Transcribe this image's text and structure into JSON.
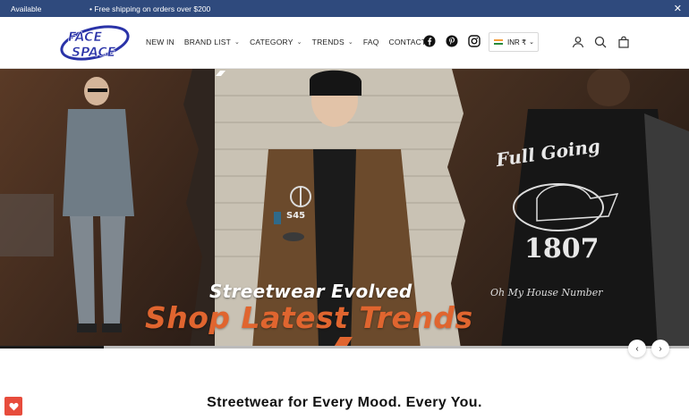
{
  "announcement": {
    "left_text": "Available",
    "shipping_text": "• Free shipping on orders over $200",
    "close_icon": "close-icon"
  },
  "header": {
    "logo_text_top": "FACE",
    "logo_text_bottom": "SPACE",
    "brand_color": "#2a33a8",
    "nav": [
      {
        "label": "NEW IN",
        "has_dropdown": false
      },
      {
        "label": "BRAND LIST",
        "has_dropdown": true
      },
      {
        "label": "CATEGORY",
        "has_dropdown": true
      },
      {
        "label": "TRENDS",
        "has_dropdown": true
      },
      {
        "label": "FAQ",
        "has_dropdown": false
      },
      {
        "label": "CONTACT",
        "has_dropdown": false
      }
    ],
    "social_icons": [
      "facebook-icon",
      "pinterest-icon",
      "instagram-icon"
    ],
    "currency": {
      "label": "INR ₹",
      "flag": "india-flag-icon"
    },
    "utility_icons": [
      "account-icon",
      "search-icon",
      "cart-icon"
    ]
  },
  "hero": {
    "headline": "Streetwear Evolved",
    "subheadline": "Shop Latest Trends",
    "jacket_script": "Full Going",
    "jacket_number": "1807",
    "jacket_caption": "Oh My House Number",
    "patch_text": "S45",
    "accent_color": "#e0652f",
    "slider": {
      "prev_icon": "chevron-left-icon",
      "next_icon": "chevron-right-icon",
      "progress": 0.15
    }
  },
  "section": {
    "title": "Streetwear for Every Mood. Every You."
  },
  "wishlist": {
    "icon": "heart-icon",
    "color": "#e74c3c"
  }
}
